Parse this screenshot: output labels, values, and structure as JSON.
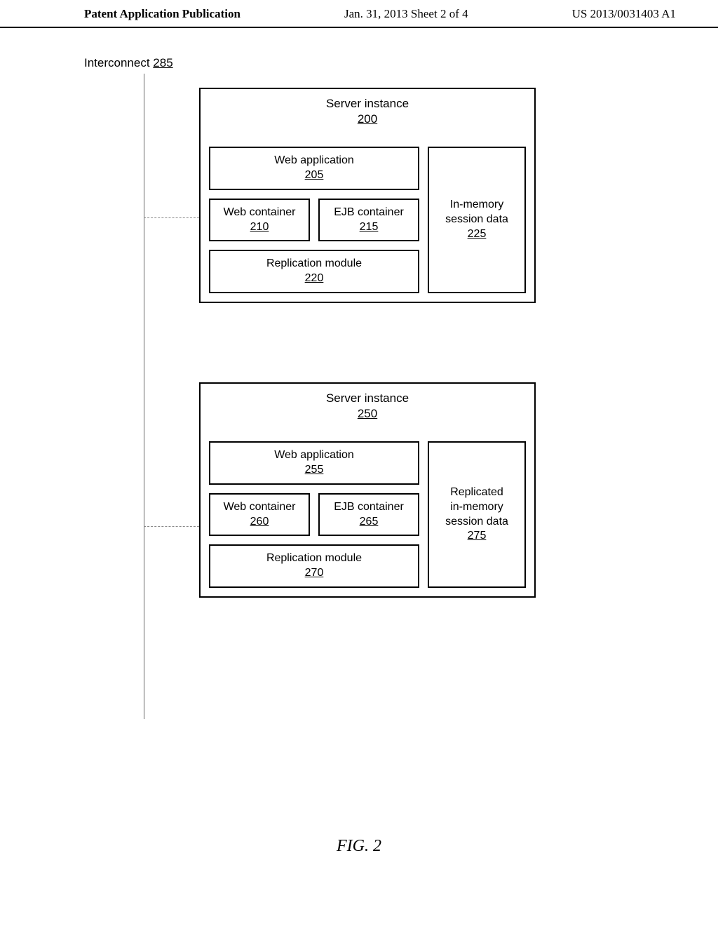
{
  "header": {
    "left": "Patent Application Publication",
    "center": "Jan. 31, 2013  Sheet 2 of 4",
    "right": "US 2013/0031403 A1"
  },
  "interconnect": {
    "label": "Interconnect",
    "ref": "285"
  },
  "server1": {
    "title": "Server instance",
    "ref": "200",
    "webapp": {
      "label": "Web application",
      "ref": "205"
    },
    "webcontainer": {
      "label": "Web container",
      "ref": "210"
    },
    "ejbcontainer": {
      "label": "EJB container",
      "ref": "215"
    },
    "replication": {
      "label": "Replication module",
      "ref": "220"
    },
    "session": {
      "line1": "In-memory",
      "line2": "session data",
      "ref": "225"
    }
  },
  "server2": {
    "title": "Server instance",
    "ref": "250",
    "webapp": {
      "label": "Web application",
      "ref": "255"
    },
    "webcontainer": {
      "label": "Web container",
      "ref": "260"
    },
    "ejbcontainer": {
      "label": "EJB container",
      "ref": "265"
    },
    "replication": {
      "label": "Replication module",
      "ref": "270"
    },
    "session": {
      "line1": "Replicated",
      "line2": "in-memory",
      "line3": "session data",
      "ref": "275"
    }
  },
  "figure_caption": "FIG. 2"
}
